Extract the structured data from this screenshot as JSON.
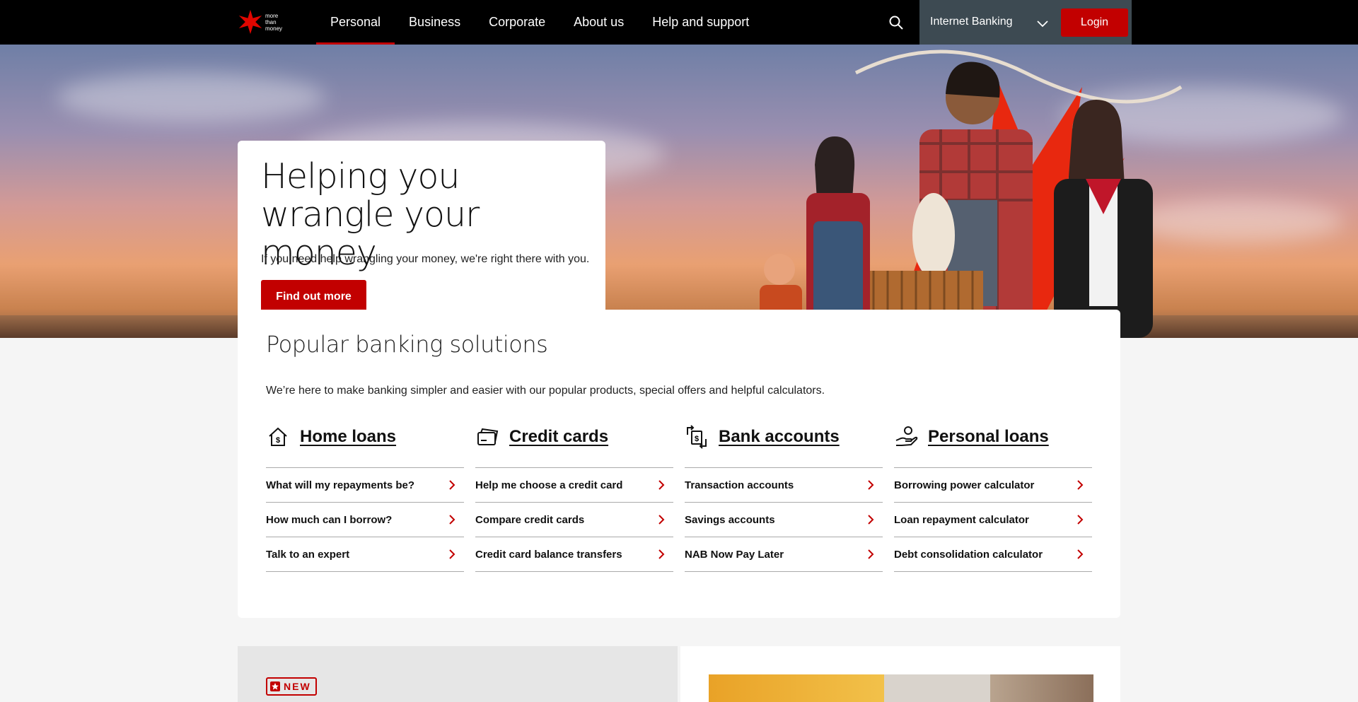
{
  "brand": {
    "logo_text_lines": [
      "more",
      "than",
      "money"
    ],
    "accent": "#c20000"
  },
  "nav": {
    "links": [
      {
        "label": "Personal",
        "active": true
      },
      {
        "label": "Business"
      },
      {
        "label": "Corporate"
      },
      {
        "label": "About us"
      },
      {
        "label": "Help and support"
      }
    ],
    "search_icon": "search-icon",
    "internet_banking": "Internet Banking",
    "login": "Login"
  },
  "hero": {
    "title": "Helping you wrangle your money",
    "subtitle": "If you need help wrangling your money, we're right there with you.",
    "cta": "Find out more"
  },
  "popular": {
    "title": "Popular banking solutions",
    "subtitle": "We’re here to make banking simpler and easier with our popular products, special offers and helpful calculators.",
    "columns": [
      {
        "title": "Home loans",
        "icon": "house-dollar-icon",
        "items": [
          "What will my repayments be?",
          "How much can I borrow?",
          "Talk to an expert"
        ]
      },
      {
        "title": "Credit cards",
        "icon": "credit-card-icon",
        "items": [
          "Help me choose a credit card",
          "Compare credit cards",
          "Credit card balance transfers"
        ]
      },
      {
        "title": "Bank accounts",
        "icon": "transfer-dollar-icon",
        "items": [
          "Transaction accounts",
          "Savings accounts",
          "NAB Now Pay Later"
        ]
      },
      {
        "title": "Personal loans",
        "icon": "hand-money-icon",
        "items": [
          "Borrowing power calculator",
          "Loan repayment calculator",
          "Debt consolidation calculator"
        ]
      }
    ]
  },
  "promo": {
    "badge": "NEW"
  }
}
